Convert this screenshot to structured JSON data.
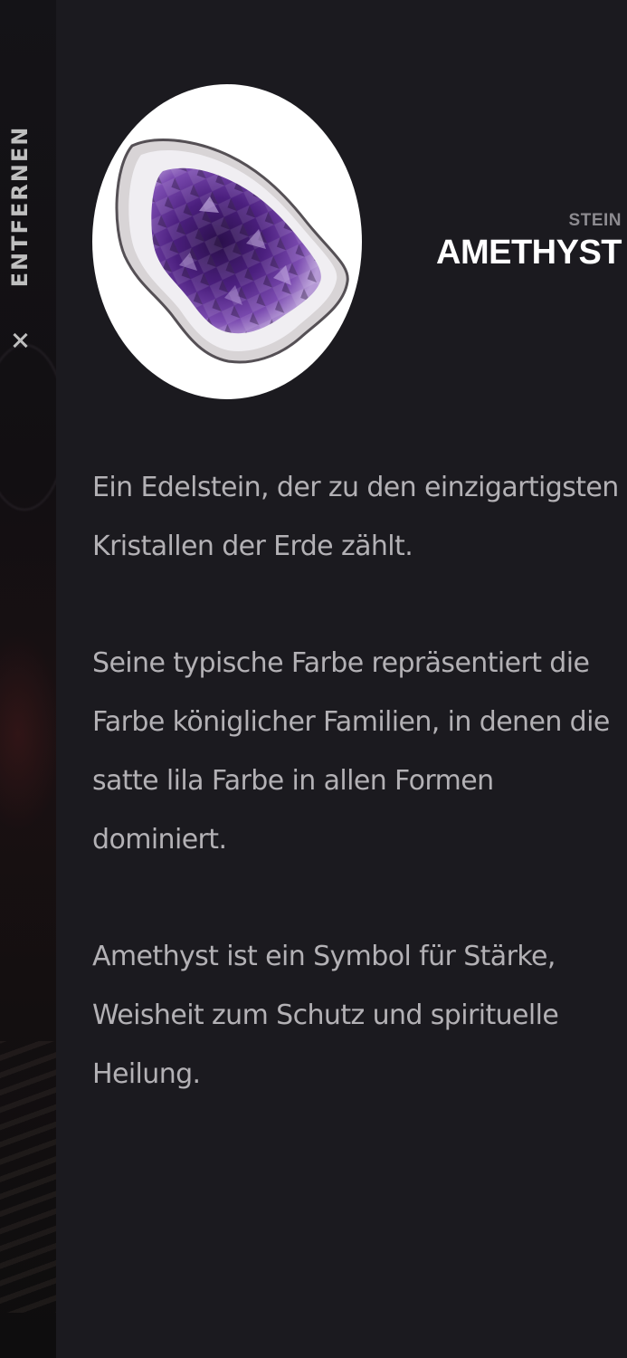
{
  "sidebar": {
    "remove_label": "ENTFERNEN",
    "close_icon": "close-icon"
  },
  "stone": {
    "category": "STEIN",
    "name": "AMETHYST",
    "image": "amethyst-geode-image",
    "description": [
      "Ein Edelstein, der zu den einzigartigsten Kristallen der Erde zählt.",
      "Seine typische Farbe repräsentiert die Farbe königlicher Familien, in denen die satte lila Farbe in allen Formen dominiert.",
      "Amethyst ist ein Symbol für Stärke, Weisheit zum Schutz und spirituelle Heilung."
    ]
  },
  "colors": {
    "panel_background": "#1b1a1f",
    "title": "#ffffff",
    "category": "#8d8b90",
    "body_text": "#b3b1b5",
    "amethyst": "#5b2a86"
  }
}
